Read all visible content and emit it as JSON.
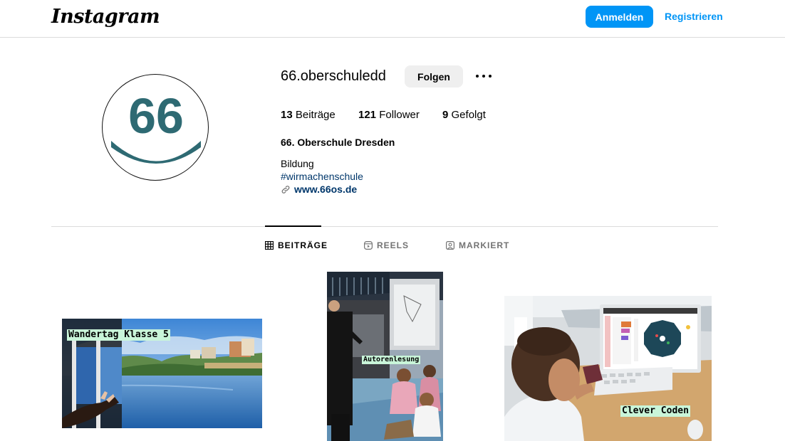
{
  "header": {
    "logo": "Instagram",
    "login_label": "Anmelden",
    "register_label": "Registrieren"
  },
  "profile": {
    "avatar_text": "66",
    "username": "66.oberschuledd",
    "follow_label": "Folgen",
    "stats": {
      "posts_count": "13",
      "posts_label": "Beiträge",
      "followers_count": "121",
      "followers_label": "Follower",
      "following_count": "9",
      "following_label": "Gefolgt"
    },
    "full_name": "66. Oberschule Dresden",
    "category": "Bildung",
    "hashtag": "#wirmachenschule",
    "website": "www.66os.de"
  },
  "tabs": [
    {
      "label": "BEITRÄGE",
      "icon": "grid-icon",
      "active": true
    },
    {
      "label": "REELS",
      "icon": "reels-icon",
      "active": false
    },
    {
      "label": "MARKIERT",
      "icon": "tagged-icon",
      "active": false
    }
  ],
  "posts": [
    {
      "caption": "Wandertag Klasse 5"
    },
    {
      "caption": "Autorenlesung"
    },
    {
      "caption": "Clever Coden"
    }
  ],
  "colors": {
    "accent": "#0095f6",
    "avatar_teal": "#2e6a73",
    "link_dark": "#00376b",
    "caption_bg": "#c9f5d9"
  }
}
